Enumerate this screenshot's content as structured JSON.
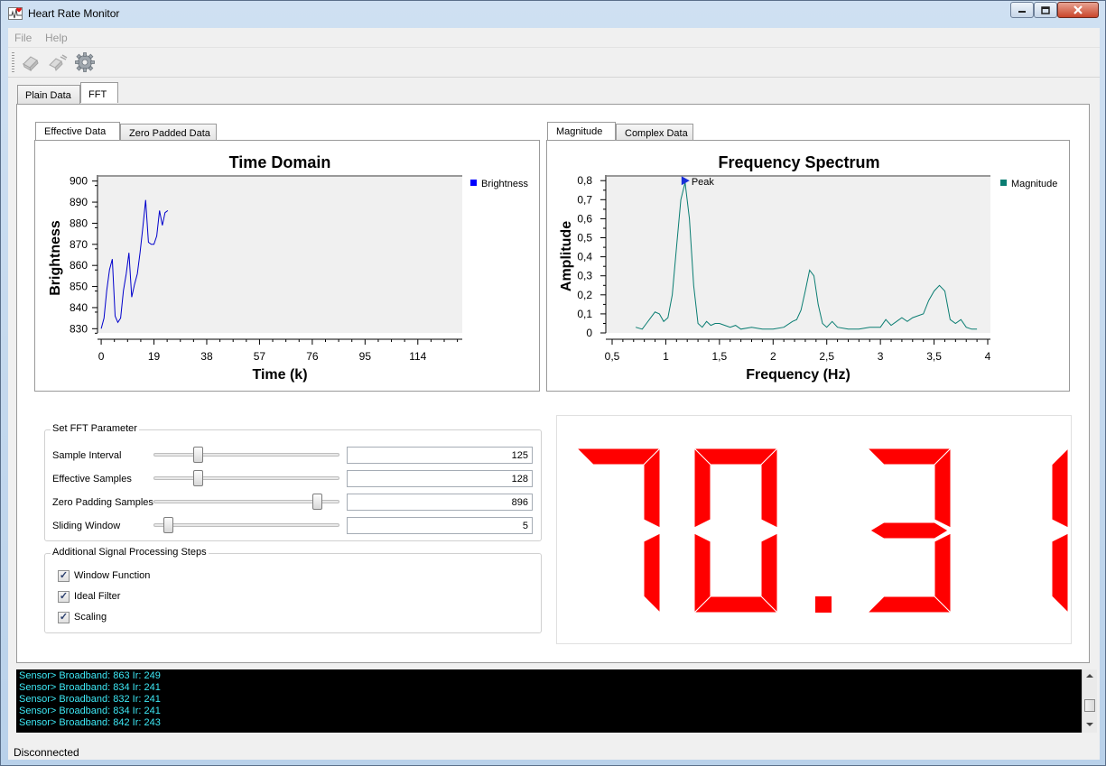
{
  "window": {
    "title": "Heart Rate Monitor"
  },
  "menu": {
    "file": "File",
    "help": "Help"
  },
  "toolbar": {
    "icons": [
      "connect-plug-icon",
      "disconnect-plug-icon",
      "settings-gear-icon"
    ]
  },
  "main_tabs": [
    {
      "label": "Plain Data"
    },
    {
      "label": "FFT"
    }
  ],
  "left_chart": {
    "tabs": [
      {
        "label": "Effective Data"
      },
      {
        "label": "Zero Padded Data"
      }
    ],
    "title": "Time Domain",
    "xlabel": "Time (k)",
    "ylabel": "Brightness",
    "legend": "Brightness",
    "x_ticks": [
      "0",
      "19",
      "38",
      "57",
      "76",
      "95",
      "114"
    ],
    "y_ticks": [
      "830",
      "840",
      "850",
      "860",
      "870",
      "880",
      "890",
      "900"
    ]
  },
  "right_chart": {
    "tabs": [
      {
        "label": "Magnitude"
      },
      {
        "label": "Complex Data"
      }
    ],
    "title": "Frequency Spectrum",
    "xlabel": "Frequency (Hz)",
    "ylabel": "Amplitude",
    "legend": "Magnitude",
    "peak_label": "Peak",
    "x_ticks": [
      "0,5",
      "1",
      "1,5",
      "2",
      "2,5",
      "3",
      "3,5",
      "4"
    ],
    "y_ticks": [
      "0",
      "0,1",
      "0,2",
      "0,3",
      "0,4",
      "0,5",
      "0,6",
      "0,7",
      "0,8"
    ]
  },
  "chart_data": [
    {
      "type": "line",
      "title": "Time Domain",
      "xlabel": "Time (k)",
      "ylabel": "Brightness",
      "xlim": [
        -1,
        130
      ],
      "ylim": [
        828,
        902
      ],
      "series": [
        {
          "name": "Brightness",
          "color": "#0000cc",
          "x": [
            0,
            1,
            2,
            3,
            4,
            5,
            6,
            7,
            8,
            9,
            10,
            11,
            12,
            13,
            14,
            15,
            16,
            17,
            18,
            19,
            20,
            21,
            22,
            23,
            24
          ],
          "y": [
            830,
            835,
            848,
            858,
            863,
            836,
            833,
            835,
            848,
            856,
            866,
            845,
            851,
            856,
            866,
            878,
            891,
            871,
            870,
            870,
            874,
            886,
            879,
            885,
            886
          ]
        }
      ]
    },
    {
      "type": "line",
      "title": "Frequency Spectrum",
      "xlabel": "Frequency (Hz)",
      "ylabel": "Amplitude",
      "xlim": [
        0.5,
        4
      ],
      "ylim": [
        0,
        0.82
      ],
      "peak": {
        "x": 1.18,
        "y": 0.8,
        "label": "Peak"
      },
      "series": [
        {
          "name": "Magnitude",
          "color": "#0a7d72",
          "x": [
            0.72,
            0.78,
            0.82,
            0.86,
            0.9,
            0.94,
            0.98,
            1.02,
            1.06,
            1.1,
            1.14,
            1.18,
            1.22,
            1.26,
            1.3,
            1.34,
            1.38,
            1.42,
            1.46,
            1.5,
            1.55,
            1.6,
            1.65,
            1.7,
            1.8,
            1.9,
            2.0,
            2.1,
            2.18,
            2.22,
            2.26,
            2.3,
            2.34,
            2.38,
            2.42,
            2.46,
            2.5,
            2.55,
            2.6,
            2.7,
            2.8,
            2.9,
            3.0,
            3.05,
            3.1,
            3.15,
            3.2,
            3.25,
            3.3,
            3.35,
            3.4,
            3.45,
            3.5,
            3.55,
            3.6,
            3.65,
            3.7,
            3.75,
            3.8,
            3.85,
            3.9
          ],
          "y": [
            0.03,
            0.02,
            0.05,
            0.08,
            0.11,
            0.1,
            0.06,
            0.08,
            0.2,
            0.45,
            0.7,
            0.79,
            0.6,
            0.25,
            0.05,
            0.03,
            0.06,
            0.04,
            0.05,
            0.05,
            0.04,
            0.03,
            0.04,
            0.02,
            0.03,
            0.02,
            0.02,
            0.03,
            0.06,
            0.07,
            0.12,
            0.22,
            0.33,
            0.3,
            0.15,
            0.05,
            0.03,
            0.06,
            0.03,
            0.02,
            0.02,
            0.03,
            0.03,
            0.07,
            0.04,
            0.06,
            0.08,
            0.06,
            0.08,
            0.09,
            0.1,
            0.17,
            0.22,
            0.25,
            0.22,
            0.07,
            0.05,
            0.07,
            0.03,
            0.02,
            0.02
          ]
        }
      ]
    }
  ],
  "fft_params": {
    "title": "Set FFT Parameter",
    "rows": [
      {
        "label": "Sample Interval",
        "value": "125",
        "level": 0.24
      },
      {
        "label": "Effective Samples",
        "value": "128",
        "level": 0.24
      },
      {
        "label": "Zero Padding Samples",
        "value": "896",
        "level": 0.88
      },
      {
        "label": "Sliding Window",
        "value": "5",
        "level": 0.08
      }
    ]
  },
  "processing_steps": {
    "title": "Additional Signal Processing Steps",
    "items": [
      {
        "label": "Window Function",
        "checked": true
      },
      {
        "label": "Ideal Filter",
        "checked": true
      },
      {
        "label": "Scaling",
        "checked": true
      }
    ]
  },
  "lcd": {
    "value": "70.31",
    "color": "#ff0000"
  },
  "console": {
    "lines": [
      "Sensor> Broadband: 863 Ir: 249",
      "Sensor> Broadband: 834 Ir: 241",
      "Sensor> Broadband: 832 Ir: 241",
      "Sensor> Broadband: 834 Ir: 241",
      "Sensor> Broadband: 842 Ir: 243"
    ]
  },
  "status": {
    "text": "Disconnected"
  }
}
